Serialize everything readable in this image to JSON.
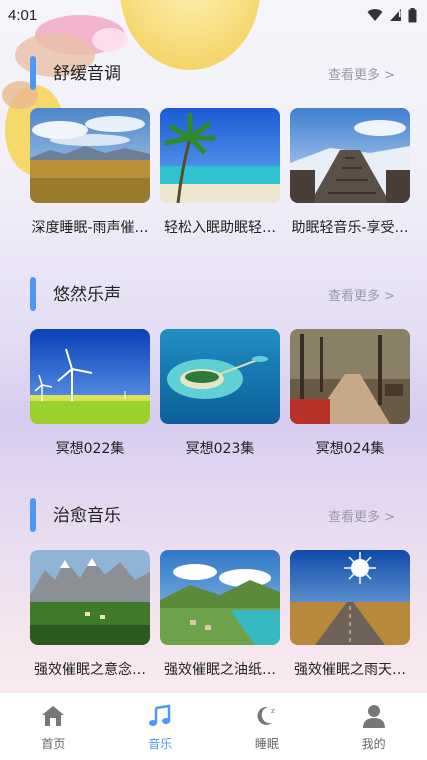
{
  "status_bar": {
    "time": "4:01"
  },
  "sections": [
    {
      "title": "舒缓音调",
      "more": "查看更多 >",
      "cards": [
        {
          "label": "深度睡眠-雨声催…",
          "thumb": "grassland-mountains-image"
        },
        {
          "label": "轻松入眠助眠轻…",
          "thumb": "tropical-beach-image"
        },
        {
          "label": "助眠轻音乐-享受…",
          "thumb": "snowy-boardwalk-image"
        }
      ]
    },
    {
      "title": "悠然乐声",
      "more": "查看更多 >",
      "cards": [
        {
          "label": "冥想022集",
          "thumb": "wind-turbines-image"
        },
        {
          "label": "冥想023集",
          "thumb": "atoll-island-image"
        },
        {
          "label": "冥想024集",
          "thumb": "autumn-park-path-image"
        }
      ]
    },
    {
      "title": "治愈音乐",
      "more": "查看更多 >",
      "cards": [
        {
          "label": "强效催眠之意念…",
          "thumb": "alpine-village-image"
        },
        {
          "label": "强效催眠之油纸…",
          "thumb": "lakeside-village-image"
        },
        {
          "label": "强效催眠之雨天…",
          "thumb": "desert-road-sun-image"
        }
      ]
    }
  ],
  "tabbar": {
    "active": 1,
    "tabs": [
      {
        "label": "首页",
        "icon": "home-icon"
      },
      {
        "label": "音乐",
        "icon": "music-note-icon"
      },
      {
        "label": "睡眠",
        "icon": "moon-icon"
      },
      {
        "label": "我的",
        "icon": "person-icon"
      }
    ]
  },
  "colors": {
    "accent": "#4a9af5",
    "more_text": "#9a9aa8"
  }
}
